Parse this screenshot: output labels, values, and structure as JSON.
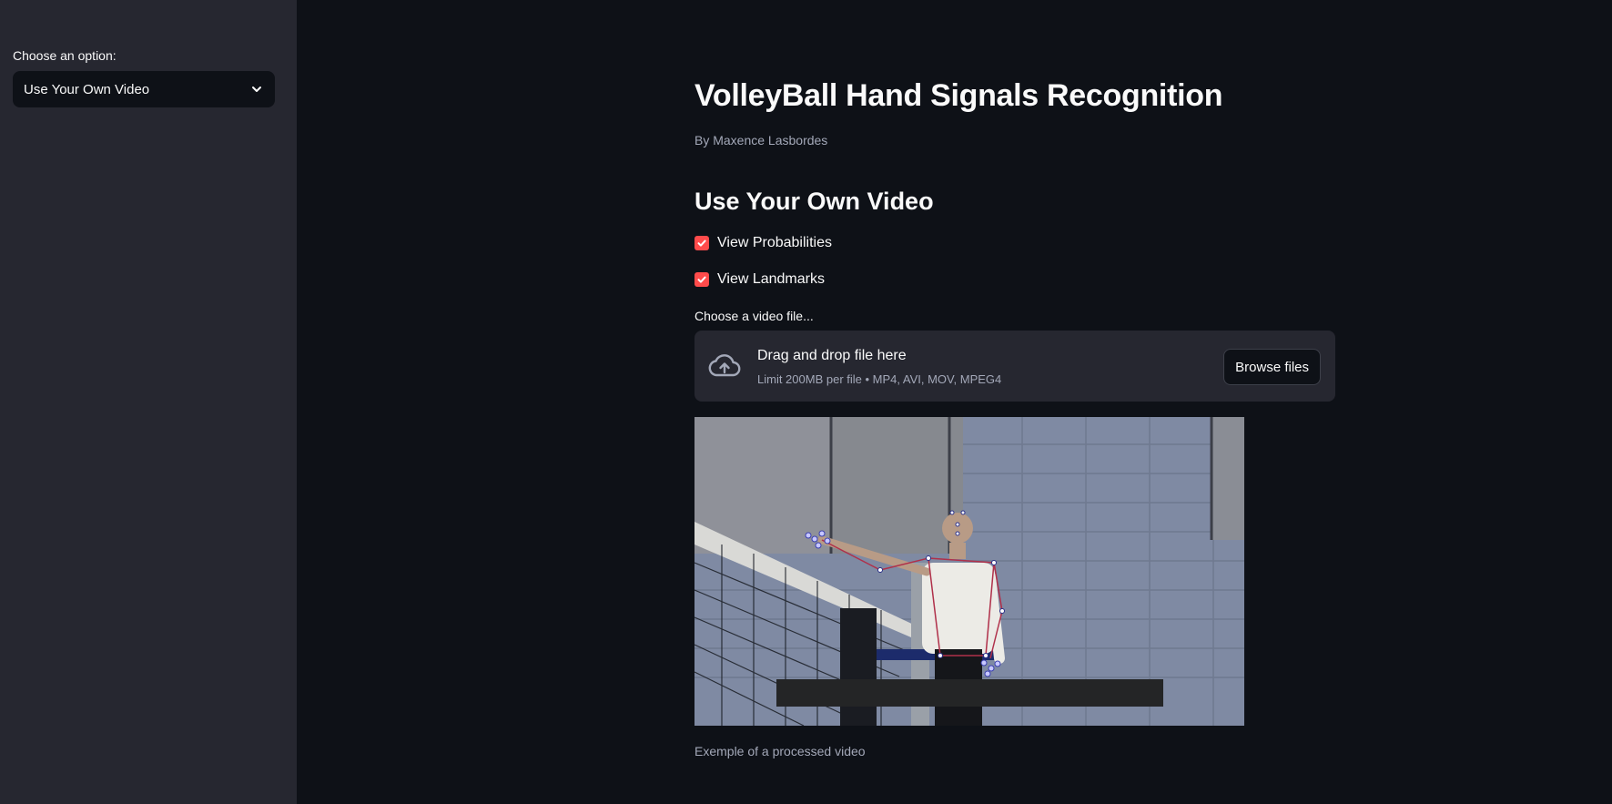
{
  "sidebar": {
    "select_label": "Choose an option:",
    "select_value": "Use Your Own Video"
  },
  "main": {
    "title": "VolleyBall Hand Signals Recognition",
    "byline": "By Maxence Lasbordes",
    "subheader": "Use Your Own Video",
    "checkboxes": [
      {
        "label": "View Probabilities",
        "checked": true
      },
      {
        "label": "View Landmarks",
        "checked": true
      }
    ],
    "uploader": {
      "label": "Choose a video file...",
      "drop_text": "Drag and drop file here",
      "limit_text": "Limit 200MB per file • MP4, AVI, MOV, MPEG4",
      "browse_label": "Browse files"
    },
    "caption": "Exemple of a processed video"
  },
  "colors": {
    "accent": "#ff4b4b",
    "background": "#0e1117",
    "sidebar": "#262730"
  }
}
